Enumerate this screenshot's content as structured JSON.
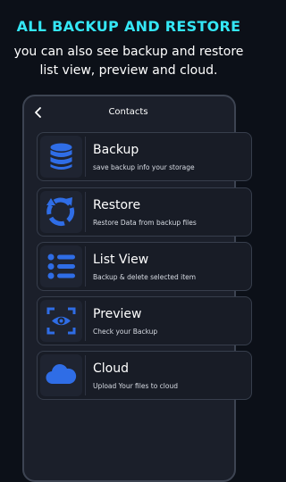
{
  "promo": {
    "title": "ALL BACKUP AND RESTORE",
    "subtitle_line1": "you can also see backup and restore",
    "subtitle_line2": "list view, preview and cloud."
  },
  "header": {
    "title": "Contacts",
    "back_icon": "chevron-left-icon"
  },
  "cards": [
    {
      "title": "Backup",
      "description": "save backup info your storage",
      "icon": "database-icon"
    },
    {
      "title": "Restore",
      "description": "Restore Data from backup files",
      "icon": "restore-icon"
    },
    {
      "title": "List View",
      "description": "Backup & delete selected item",
      "icon": "list-icon"
    },
    {
      "title": "Preview",
      "description": "Check your Backup",
      "icon": "eye-scan-icon"
    },
    {
      "title": "Cloud",
      "description": "Upload Your files to cloud",
      "icon": "cloud-icon"
    }
  ],
  "colors": {
    "accent": "#34e6f5",
    "icon_blue": "#2f6de6",
    "background": "#0c1018",
    "card": "#181c26"
  }
}
